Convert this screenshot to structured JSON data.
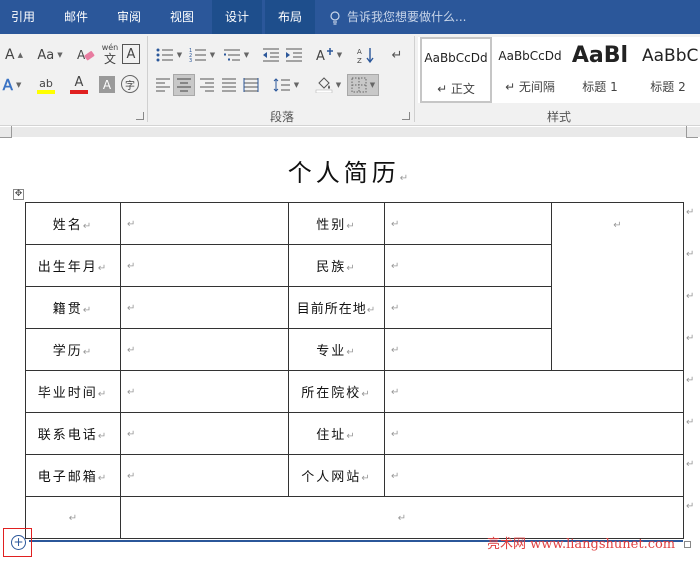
{
  "tabs": [
    {
      "label": "引用",
      "active": false
    },
    {
      "label": "邮件",
      "active": false
    },
    {
      "label": "审阅",
      "active": false
    },
    {
      "label": "视图",
      "active": false
    },
    {
      "label": "设计",
      "active": true
    },
    {
      "label": "布局",
      "active": true
    }
  ],
  "tell_me": {
    "placeholder": "告诉我您想要做什么..."
  },
  "ribbon": {
    "font_group": {
      "grow_font": "A",
      "change_case": "Aa",
      "phonetic_guide": "wén",
      "phonetic_guide_sub": "文",
      "char_border": "A",
      "text_effects": "A",
      "highlight": "ab",
      "font_color": "A",
      "char_shading": "A",
      "enclose_char": "字"
    },
    "paragraph_group": {
      "label": "段落"
    },
    "styles_group": {
      "label": "样式",
      "items": [
        {
          "preview": "AaBbCcDd",
          "name": "↵ 正文",
          "selected": true
        },
        {
          "preview": "AaBbCcDd",
          "name": "↵ 无间隔",
          "selected": false
        },
        {
          "preview": "AaBl",
          "name": "标题 1",
          "selected": false
        },
        {
          "preview": "AaBbC",
          "name": "标题 2",
          "selected": false
        }
      ]
    },
    "colors": {
      "highlight": "#ffff00",
      "font_color": "#e02020"
    }
  },
  "document": {
    "title": "个人简历",
    "mark": "↵",
    "table": {
      "rows": [
        [
          "姓名",
          "",
          "性别",
          "",
          ""
        ],
        [
          "出生年月",
          "",
          "民族",
          ""
        ],
        [
          "籍贯",
          "",
          "目前所在地",
          ""
        ],
        [
          "学历",
          "",
          "专业",
          ""
        ],
        [
          "毕业时间",
          "",
          "所在院校",
          ""
        ],
        [
          "联系电话",
          "",
          "住址",
          ""
        ],
        [
          "电子邮箱",
          "",
          "个人网站",
          ""
        ],
        [
          "",
          ""
        ]
      ]
    }
  },
  "watermark": "亮术网 www.liangshunet.com",
  "colors": {
    "tab_bar": "#2b579a",
    "active_tab": "#1e4e8c",
    "ribbon_bg": "#f1f1f1",
    "border_accent": "#e02020"
  }
}
